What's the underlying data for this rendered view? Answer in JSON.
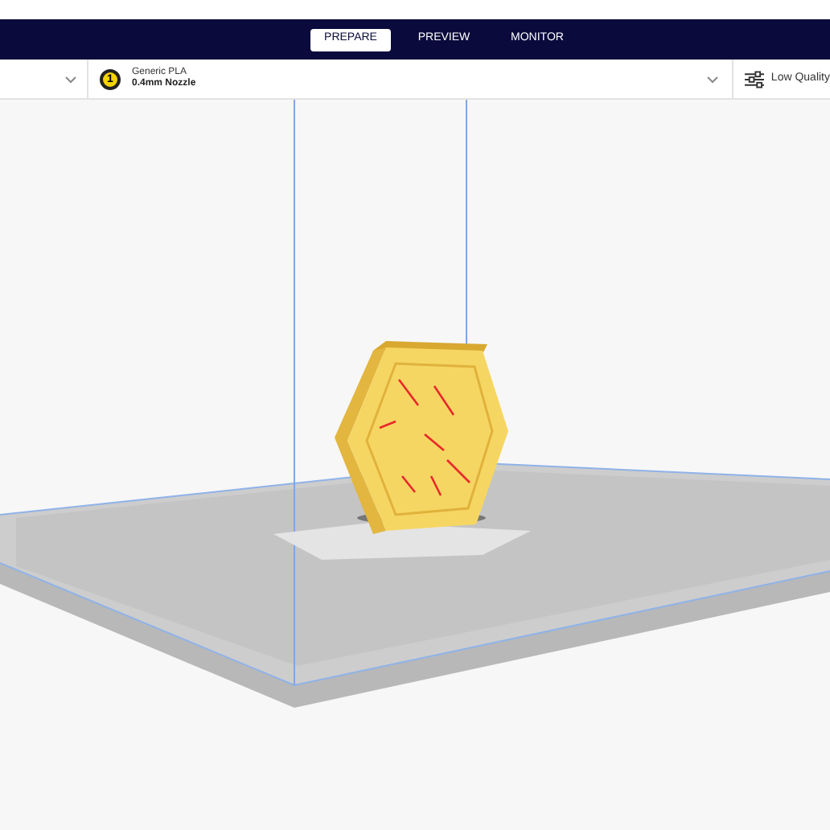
{
  "tabs": [
    {
      "label": "PREPARE",
      "selected": true
    },
    {
      "label": "PREVIEW",
      "selected": false
    },
    {
      "label": "MONITOR",
      "selected": false
    }
  ],
  "extruder": {
    "number": "1",
    "material": "Generic PLA",
    "nozzle": "0.4mm Nozzle"
  },
  "print_settings": {
    "label": "Low Quality"
  }
}
